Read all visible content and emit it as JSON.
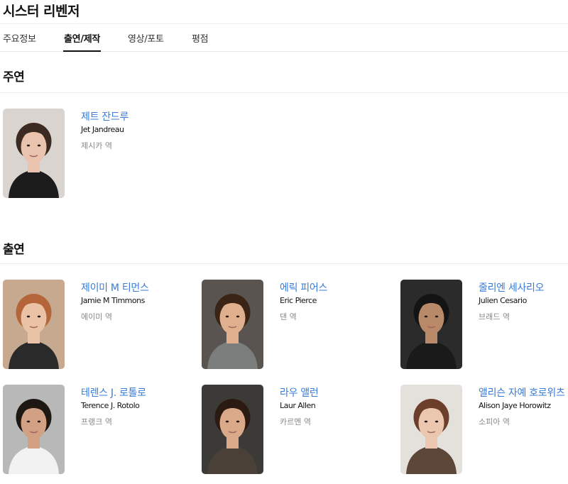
{
  "page": {
    "title": "시스터 리벤저"
  },
  "tabs": [
    {
      "label": "주요정보",
      "active": false
    },
    {
      "label": "출연/제작",
      "active": true
    },
    {
      "label": "영상/포토",
      "active": false
    },
    {
      "label": "평점",
      "active": false
    }
  ],
  "sections": {
    "lead": {
      "title": "주연",
      "people": [
        {
          "korean_name": "제트 잔드루",
          "english_name": "Jet Jandreau",
          "role": "제시카 역",
          "skin": "#e9c3ae",
          "hair": "#3b2a22",
          "bg": "#d9d4cf",
          "cloth": "#1c1c1c"
        }
      ]
    },
    "supporting": {
      "title": "출연",
      "people": [
        {
          "korean_name": "제이미 M 티먼스",
          "english_name": "Jamie M Timmons",
          "role": "에이미 역",
          "skin": "#eac2a6",
          "hair": "#b5653a",
          "bg": "#c7a98f",
          "cloth": "#2a2a2a"
        },
        {
          "korean_name": "에릭 피어스",
          "english_name": "Eric Pierce",
          "role": "댄 역",
          "skin": "#e0b08e",
          "hair": "#3a2416",
          "bg": "#5a5450",
          "cloth": "#7b7e7c"
        },
        {
          "korean_name": "줄리엔 세사리오",
          "english_name": "Julien Cesario",
          "role": "브래드 역",
          "skin": "#b98a6a",
          "hair": "#141414",
          "bg": "#2b2b2b",
          "cloth": "#1a1a1a"
        },
        {
          "korean_name": "테렌스 J. 로톨로",
          "english_name": "Terence J. Rotolo",
          "role": "프랭크 역",
          "skin": "#d2a184",
          "hair": "#1f1712",
          "bg": "#b8b8b8",
          "cloth": "#f2f2f2"
        },
        {
          "korean_name": "라우 앨런",
          "english_name": "Laur Allen",
          "role": "카르멘 역",
          "skin": "#d9a98a",
          "hair": "#2b1a12",
          "bg": "#3c3a37",
          "cloth": "#4a4038"
        },
        {
          "korean_name": "앨리슨 자예 호로위츠",
          "english_name": "Alison Jaye Horowitz",
          "role": "소피아 역",
          "skin": "#ecc7b0",
          "hair": "#6b3f2a",
          "bg": "#e4e0dc",
          "cloth": "#5b4638"
        }
      ]
    }
  }
}
